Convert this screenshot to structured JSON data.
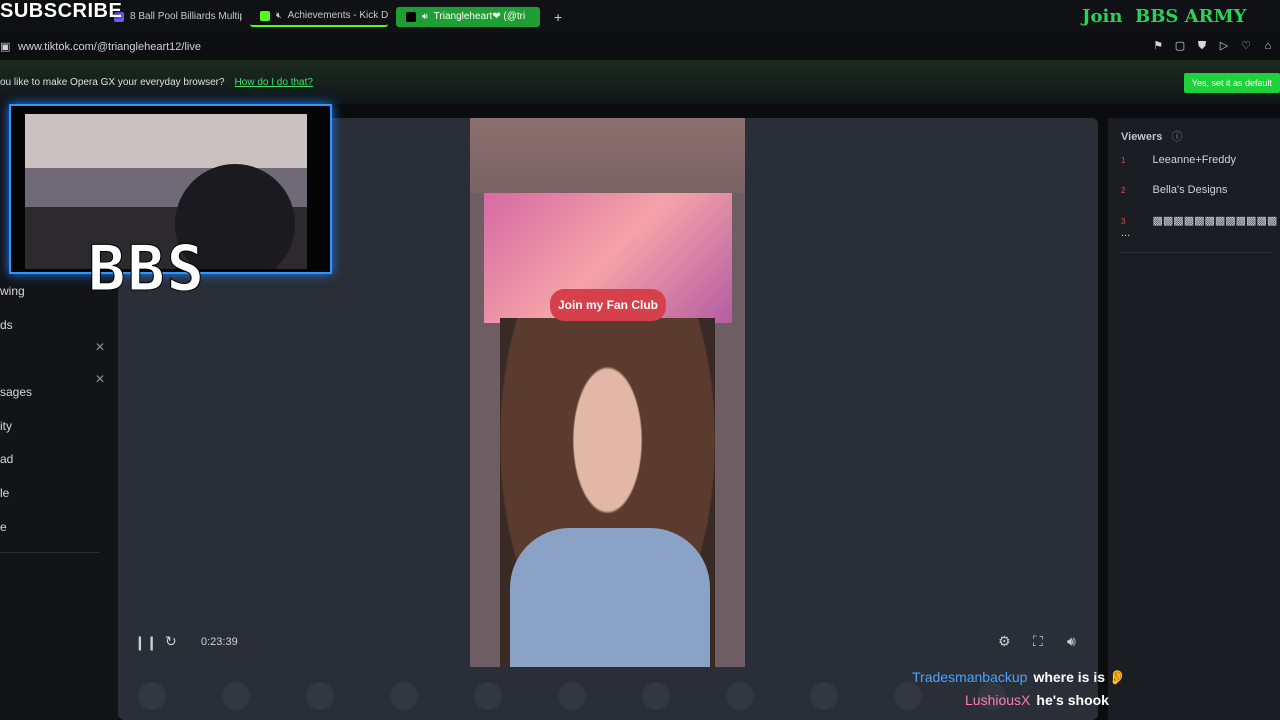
{
  "browser": {
    "tabs": [
      {
        "label": "8 Ball Pool Billiards Multip",
        "fav_color": "#6b5cff"
      },
      {
        "label": "Achievements - Kick D",
        "fav_color": "#53fc18"
      },
      {
        "label": "Triangleheart❤ (@tri",
        "fav_color": "#000000"
      }
    ],
    "new_tab_label": "+",
    "url": "www.tiktok.com/@triangleheart12/live",
    "prompt_text": "ou like to make Opera GX your everyday browser?",
    "prompt_link": "How do I do that?",
    "default_button": "Yes, set it as default"
  },
  "overlay": {
    "subscribe": "SUBSCRIBE",
    "join": "Join",
    "army": "BBS ARMY",
    "bbs": "BBS"
  },
  "sidebar": {
    "items": [
      "wing",
      "ds",
      "sages",
      "ity",
      "ad",
      "le",
      "e"
    ]
  },
  "stage": {
    "fan_club": "Join my Fan Club",
    "time": "0:23:39"
  },
  "viewers": {
    "title": "Viewers",
    "rows": [
      {
        "rank": "1",
        "name": "Leeanne+Freddy"
      },
      {
        "rank": "2",
        "name": "Bella's Designs"
      },
      {
        "rank": "3",
        "name": "▩▩▩▩▩▩▩▩▩▩▩▩ ..."
      }
    ]
  },
  "chat": [
    {
      "user": "Tradesmanbackup",
      "msg": "where is is 👂"
    },
    {
      "user": "LushiousX",
      "msg": "he's shook"
    }
  ],
  "colors": {
    "accent": "#1fd13a",
    "cam_border": "#2e96ff"
  }
}
